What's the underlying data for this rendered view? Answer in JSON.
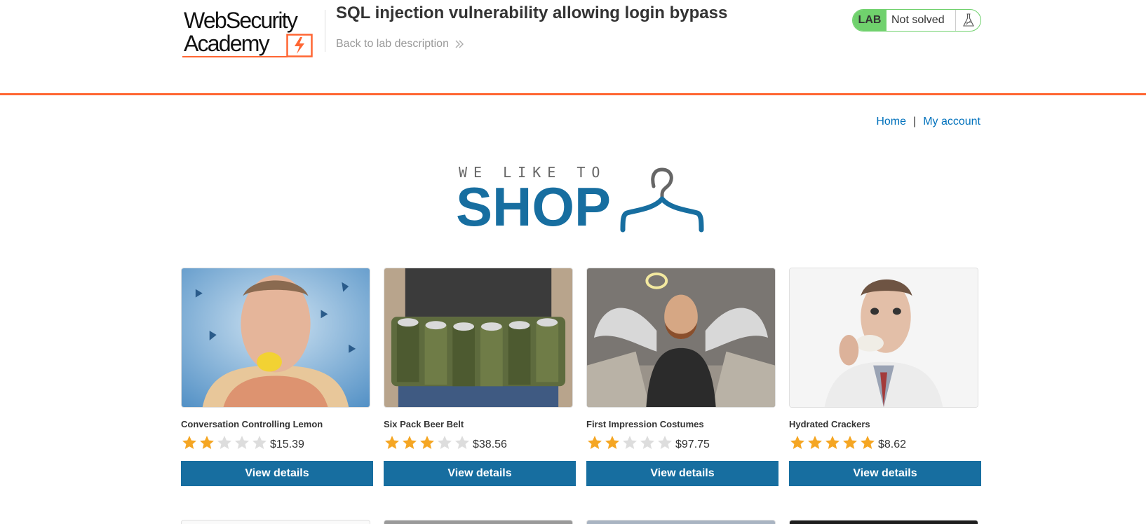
{
  "lab_header": {
    "logo_line1": "WebSecurity",
    "logo_line2": "Academy",
    "title": "SQL injection vulnerability allowing login bypass",
    "back_link": "Back to lab description",
    "lab_badge": "LAB",
    "status": "Not solved",
    "status_icon": "flask-icon",
    "accent_color": "#ff6633",
    "status_color": "#70d16d"
  },
  "nav": {
    "home": "Home",
    "separator": "|",
    "my_account": "My account"
  },
  "banner": {
    "top": "WE LIKE TO",
    "main": "SHOP",
    "icon": "hanger-icon",
    "color": "#176ea0"
  },
  "products": [
    {
      "name": "Conversation Controlling Lemon",
      "rating": 2,
      "price": "$15.39",
      "button": "View details",
      "image": "man-biting-lemon"
    },
    {
      "name": "Six Pack Beer Belt",
      "rating": 3,
      "price": "$38.56",
      "button": "View details",
      "image": "beer-can-belt"
    },
    {
      "name": "First Impression Costumes",
      "rating": 2,
      "price": "$97.75",
      "button": "View details",
      "image": "bearded-man-angel-wings"
    },
    {
      "name": "Hydrated Crackers",
      "rating": 5,
      "price": "$8.62",
      "button": "View details",
      "image": "man-eating-cracker"
    }
  ],
  "colors": {
    "button": "#176ea0",
    "link": "#0071bc",
    "star_filled": "#f5a623",
    "star_empty": "#dddddd"
  }
}
